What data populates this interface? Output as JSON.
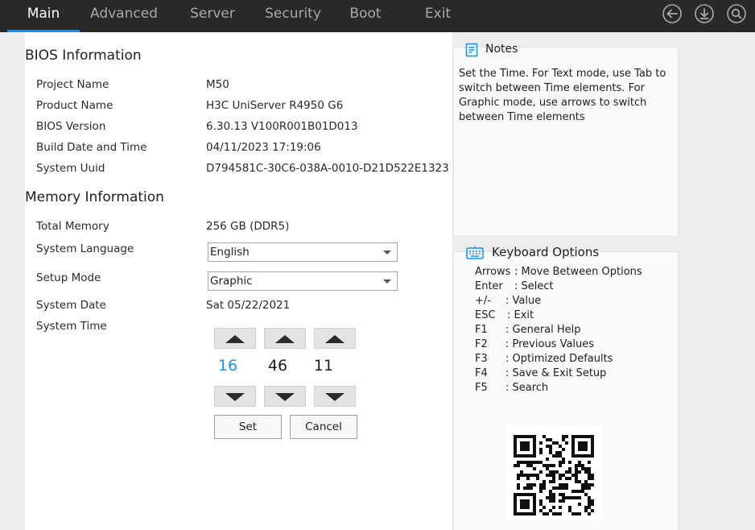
{
  "menu": {
    "tabs": [
      {
        "label": "Main",
        "active": true
      },
      {
        "label": "Advanced"
      },
      {
        "label": "Server"
      },
      {
        "label": "Security"
      },
      {
        "label": "Boot"
      },
      {
        "label": "Exit"
      }
    ],
    "icons": [
      "back-icon",
      "download-save-icon",
      "search-icon"
    ],
    "accent_color": "#1b8ee8"
  },
  "bios_info": {
    "title": "BIOS Information",
    "rows": [
      {
        "label": "Project Name",
        "value": "M50"
      },
      {
        "label": "Product Name",
        "value": "H3C UniServer R4950 G6"
      },
      {
        "label": "BIOS Version",
        "value": "6.30.13 V100R001B01D013"
      },
      {
        "label": "Build Date and Time",
        "value": "04/11/2023 17:19:06"
      },
      {
        "label": "System Uuid",
        "value": "D794581C-30C6-038A-0010-D21D522E1323"
      }
    ]
  },
  "memory_info": {
    "title": "Memory Information",
    "total_memory": {
      "label": "Total Memory",
      "value": "256 GB (DDR5)"
    },
    "language": {
      "label": "System Language",
      "selected": "English"
    },
    "setup_mode": {
      "label": "Setup Mode",
      "selected": "Graphic"
    },
    "system_date": {
      "label": "System Date",
      "value": "Sat 05/22/2021"
    },
    "system_time": {
      "label": "System Time",
      "hour": "16",
      "minute": "46",
      "second": "11",
      "active_field": "hour"
    }
  },
  "buttons": {
    "set": "Set",
    "cancel": "Cancel"
  },
  "notes": {
    "title": "Notes",
    "text": "Set the Time. For Text mode, use Tab to switch between Time elements. For Graphic mode, use arrows to switch between Time elements"
  },
  "keyboard": {
    "title": "Keyboard Options",
    "items": [
      {
        "key": "Arrows",
        "desc": ": Move Between Options"
      },
      {
        "key": "Enter",
        "desc": ": Select"
      },
      {
        "key": "+/-",
        "desc": ": Value"
      },
      {
        "key": "ESC",
        "desc": ": Exit"
      },
      {
        "key": "F1",
        "desc": ": General Help"
      },
      {
        "key": "F2",
        "desc": ": Previous Values"
      },
      {
        "key": "F3",
        "desc": ": Optimized Defaults"
      },
      {
        "key": "F4",
        "desc": ": Save & Exit Setup"
      },
      {
        "key": "F5",
        "desc": ": Search"
      }
    ]
  }
}
